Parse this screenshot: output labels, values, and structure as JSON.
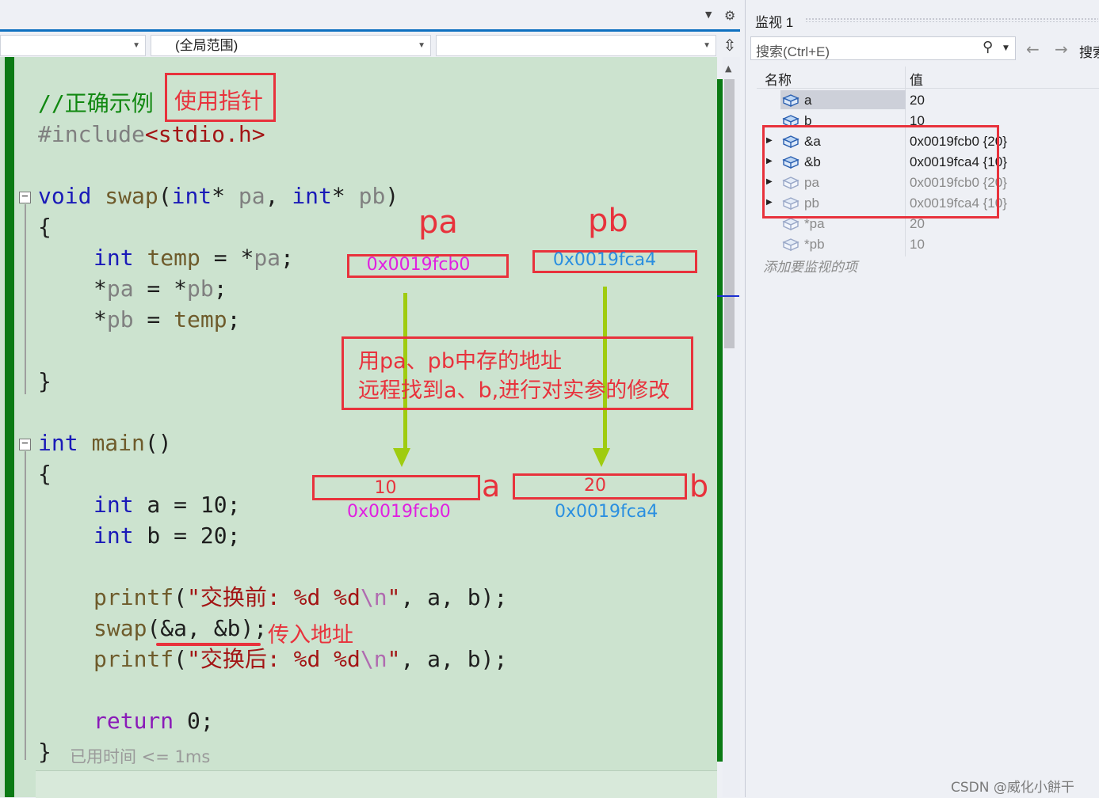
{
  "nav": {
    "scope_dropdown": "(全局范围)"
  },
  "code": {
    "comment": "//正确示例",
    "include_kw": "#include",
    "include_file": "<stdio.h>",
    "swap_sig": {
      "kw1": "void",
      "name": "swap",
      "open": "(",
      "t1": "int",
      "star1": "*",
      "p1": "pa",
      "comma": ",",
      "t2": "int",
      "star2": "*",
      "p2": "pb",
      "close": ")"
    },
    "brace_open": "{",
    "brace_close": "}",
    "line_temp": {
      "kw": "int",
      "var": "temp",
      "rest": " = *",
      "p": "pa",
      "end": ";"
    },
    "line_pa": {
      "star": "*",
      "p": "pa",
      "mid": " = *",
      "p2": "pb",
      "end": ";"
    },
    "line_pb": {
      "star": "*",
      "p": "pb",
      "mid": " = ",
      "v": "temp",
      "end": ";"
    },
    "main_sig": {
      "kw": "int",
      "name": "main",
      "parens": "()"
    },
    "line_a": {
      "kw": "int",
      "rest": " a = 10;"
    },
    "line_b": {
      "kw": "int",
      "rest": " b = 20;"
    },
    "printf1": {
      "fn": "printf",
      "open": "(",
      "str": "\"交换前: %d %d",
      "esc": "\\n",
      "strend": "\"",
      "rest": ", a, b);"
    },
    "swapcall": {
      "fn": "swap",
      "args": "(&a, &b)",
      "end": ";"
    },
    "printf2": {
      "fn": "printf",
      "open": "(",
      "str": "\"交换后: %d %d",
      "esc": "\\n",
      "strend": "\"",
      "rest": ", a, b);"
    },
    "return_line": {
      "kw": "return",
      "rest": " 0;"
    },
    "elapsed": "已用时间 <= 1ms"
  },
  "annotations": {
    "use_pointer": "使用指针",
    "pa_label": "pa",
    "pb_label": "pb",
    "pa_addr": "0x0019fcb0",
    "pb_addr": "0x0019fca4",
    "explain_line1": "用pa、pb中存的地址",
    "explain_line2": "远程找到a、b,进行对实参的修改",
    "a_value": "10",
    "b_value": "20",
    "a_label": "a",
    "b_label": "b",
    "a_addr": "0x0019fcb0",
    "b_addr": "0x0019fca4",
    "pass_addr": "传入地址"
  },
  "watch": {
    "title": "监视 1",
    "search_placeholder": "搜索(Ctrl+E)",
    "search_depth_label": "搜索",
    "col_name": "名称",
    "col_value": "值",
    "rows": [
      {
        "name": "a",
        "value": "20",
        "expandable": false,
        "dim": false
      },
      {
        "name": "b",
        "value": "10",
        "expandable": false,
        "dim": false
      },
      {
        "name": "&a",
        "value": "0x0019fcb0 {20}",
        "expandable": true,
        "dim": false
      },
      {
        "name": "&b",
        "value": "0x0019fca4 {10}",
        "expandable": true,
        "dim": false
      },
      {
        "name": "pa",
        "value": "0x0019fcb0 {20}",
        "expandable": true,
        "dim": true
      },
      {
        "name": "pb",
        "value": "0x0019fca4 {10}",
        "expandable": true,
        "dim": true
      },
      {
        "name": "*pa",
        "value": "20",
        "expandable": false,
        "dim": true
      },
      {
        "name": "*pb",
        "value": "10",
        "expandable": false,
        "dim": true
      }
    ],
    "add_watch": "添加要监视的项"
  },
  "watermark": "CSDN @威化小餅干",
  "colors": {
    "annotation_red": "#e8323c",
    "pa_magenta": "#e020e0",
    "pb_blue": "#2a8fe0",
    "arrow_green": "#9fcc10",
    "editor_bg": "#cce3cf"
  }
}
